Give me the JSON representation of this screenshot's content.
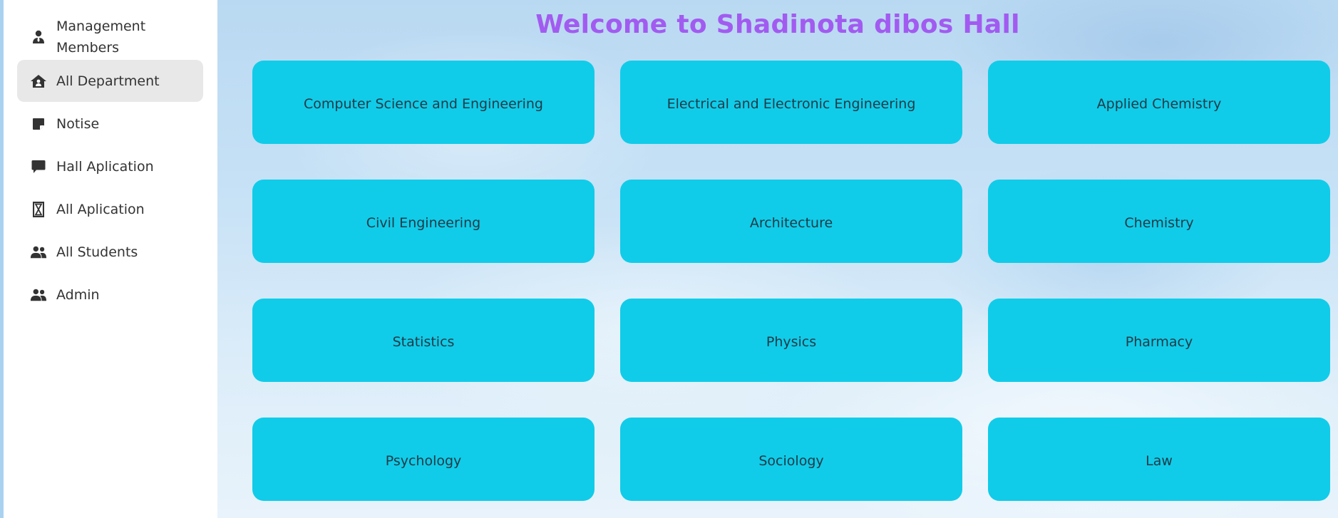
{
  "sidebar": {
    "items": [
      {
        "label": "Management Members",
        "icon": "user-tie-icon"
      },
      {
        "label": "All Department",
        "icon": "house-user-icon",
        "active": true
      },
      {
        "label": "Notise",
        "icon": "note-icon"
      },
      {
        "label": "Hall Aplication",
        "icon": "comment-icon"
      },
      {
        "label": "All Aplication",
        "icon": "hourglass-icon"
      },
      {
        "label": "All Students",
        "icon": "users-icon"
      },
      {
        "label": "Admin",
        "icon": "users-icon"
      }
    ]
  },
  "main": {
    "title": "Welcome to Shadinota dibos Hall",
    "departments": [
      "Computer Science and Engineering",
      "Electrical and Electronic Engineering",
      "Applied Chemistry",
      "Civil Engineering",
      "Architecture",
      "Chemistry",
      "Statistics",
      "Physics",
      "Pharmacy",
      "Psychology",
      "Sociology",
      "Law"
    ]
  },
  "colors": {
    "title": "#a25bf0",
    "card": "#10cce9",
    "sidebar_active": "#e8e8e8"
  }
}
